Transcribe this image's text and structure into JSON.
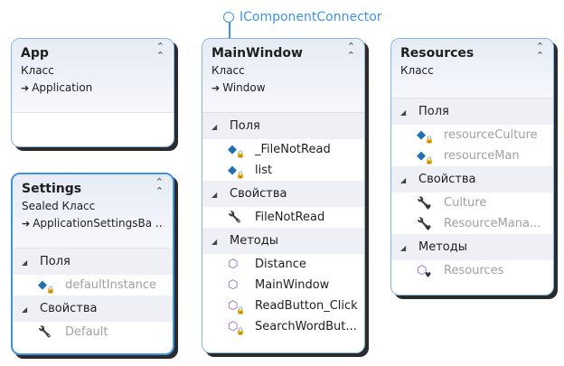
{
  "interface": {
    "name": "IComponentConnector"
  },
  "classes": [
    {
      "id": "app",
      "name": "App",
      "kind": "Класс",
      "base": "Application",
      "sections": []
    },
    {
      "id": "settings",
      "name": "Settings",
      "kind": "Sealed Класс",
      "base": "ApplicationSettingsBa ...",
      "selected": true,
      "sections": [
        {
          "label": "Поля",
          "items": [
            {
              "name": "defaultInstance",
              "icon": "field",
              "mod": "private",
              "faded": true
            }
          ]
        },
        {
          "label": "Свойства",
          "items": [
            {
              "name": "Default",
              "icon": "property",
              "mod": "",
              "faded": true
            }
          ]
        }
      ]
    },
    {
      "id": "mainwindow",
      "name": "MainWindow",
      "kind": "Класс",
      "base": "Window",
      "sections": [
        {
          "label": "Поля",
          "items": [
            {
              "name": "_FileNotRead",
              "icon": "field",
              "mod": "private"
            },
            {
              "name": "list",
              "icon": "field",
              "mod": "private"
            }
          ]
        },
        {
          "label": "Свойства",
          "items": [
            {
              "name": "FileNotRead",
              "icon": "property",
              "mod": ""
            }
          ]
        },
        {
          "label": "Методы",
          "items": [
            {
              "name": "Distance",
              "icon": "method",
              "mod": ""
            },
            {
              "name": "MainWindow",
              "icon": "method",
              "mod": ""
            },
            {
              "name": "ReadButton_Click",
              "icon": "method",
              "mod": "private"
            },
            {
              "name": "SearchWordBut...",
              "icon": "method",
              "mod": "private"
            }
          ]
        }
      ]
    },
    {
      "id": "resources",
      "name": "Resources",
      "kind": "Класс",
      "sections": [
        {
          "label": "Поля",
          "items": [
            {
              "name": "resourceCulture",
              "icon": "field",
              "mod": "private",
              "faded": true
            },
            {
              "name": "resourceMan",
              "icon": "field",
              "mod": "private",
              "faded": true
            }
          ]
        },
        {
          "label": "Свойства",
          "items": [
            {
              "name": "Culture",
              "icon": "property",
              "mod": "internal",
              "faded": true
            },
            {
              "name": "ResourceMana...",
              "icon": "property",
              "mod": "internal",
              "faded": true
            }
          ]
        },
        {
          "label": "Методы",
          "items": [
            {
              "name": "Resources",
              "icon": "method",
              "mod": "internal",
              "faded": true
            }
          ]
        }
      ]
    }
  ]
}
